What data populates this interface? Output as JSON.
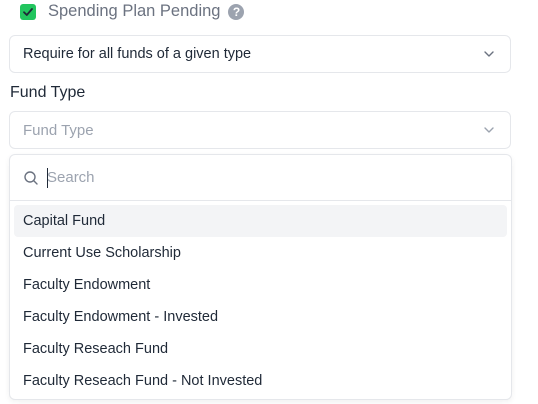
{
  "spending_plan": {
    "checked": true,
    "label": "Spending Plan Pending",
    "help_glyph": "?",
    "accent_color": "#22c55e"
  },
  "requirement_select": {
    "value": "Require for all funds of a given type"
  },
  "fund_type": {
    "label": "Fund Type",
    "placeholder": "Fund Type",
    "search_placeholder": "Search",
    "options": [
      "Capital Fund",
      "Current Use Scholarship",
      "Faculty Endowment",
      "Faculty Endowment - Invested",
      "Faculty Reseach Fund",
      "Faculty Reseach Fund - Not Invested"
    ],
    "highlighted_index": 0
  }
}
